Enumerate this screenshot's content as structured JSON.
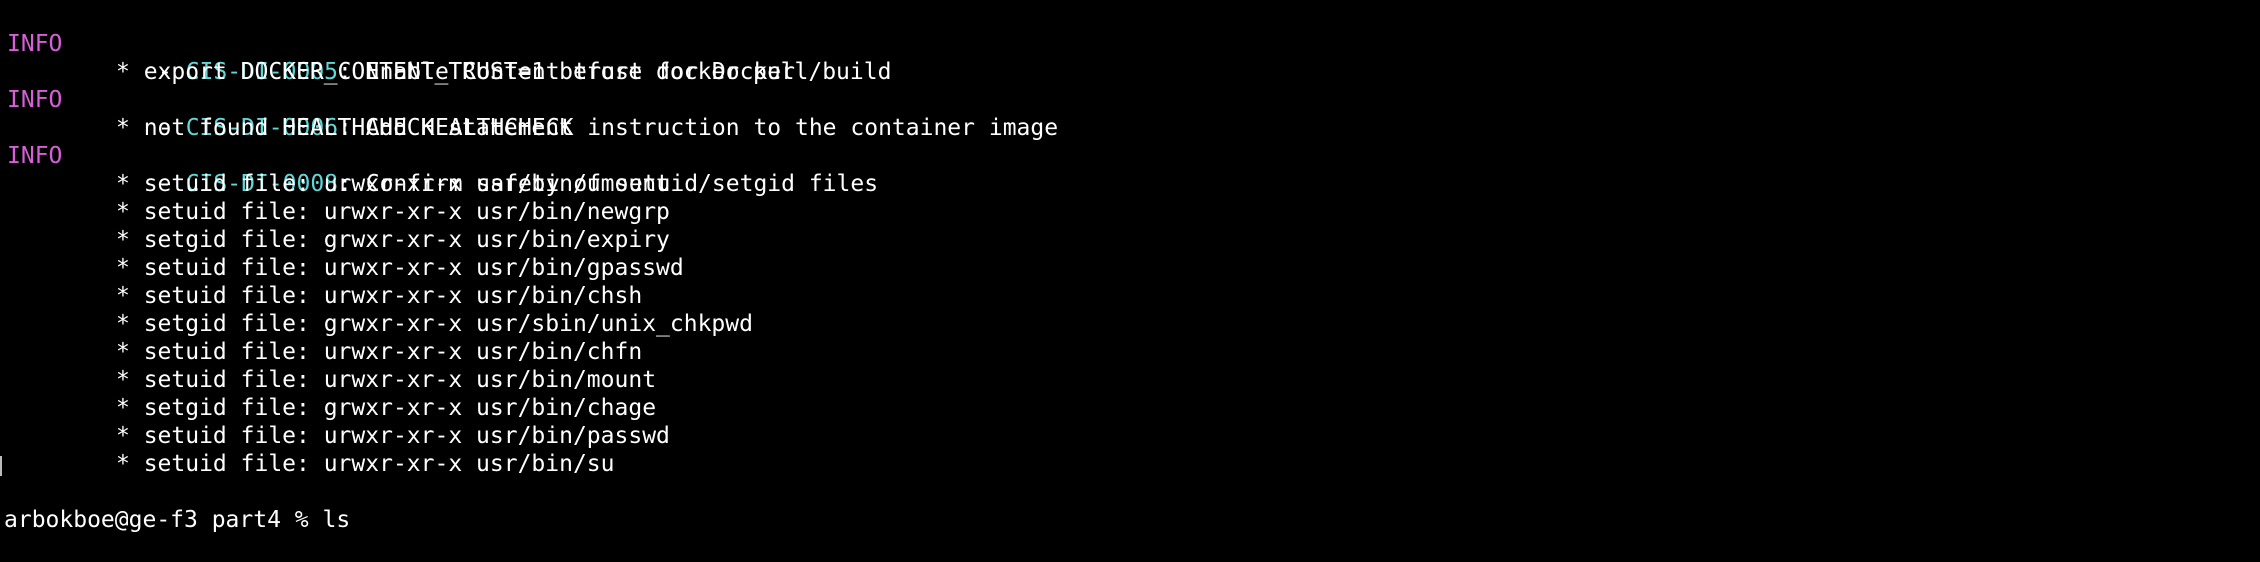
{
  "checks": [
    {
      "level": "INFO",
      "code": "CIS-DI-0005",
      "title": ": Enable Content trust for Docker",
      "details": [
        "* export DOCKER_CONTENT_TRUST=1 before docker pull/build"
      ]
    },
    {
      "level": "INFO",
      "code": "CIS-DI-0006",
      "title": ": Add HEALTHCHECK instruction to the container image",
      "details": [
        "* not found HEALTHCHECK statement"
      ]
    },
    {
      "level": "INFO",
      "code": "CIS-DI-0008",
      "title": ": Confirm safety of setuid/setgid files",
      "details": [
        "* setuid file: urwxr-xr-x usr/bin/umount",
        "* setuid file: urwxr-xr-x usr/bin/newgrp",
        "* setgid file: grwxr-xr-x usr/bin/expiry",
        "* setuid file: urwxr-xr-x usr/bin/gpasswd",
        "* setuid file: urwxr-xr-x usr/bin/chsh",
        "* setgid file: grwxr-xr-x usr/sbin/unix_chkpwd",
        "* setuid file: urwxr-xr-x usr/bin/chfn",
        "* setuid file: urwxr-xr-x usr/bin/mount",
        "* setgid file: grwxr-xr-x usr/bin/chage",
        "* setuid file: urwxr-xr-x usr/bin/passwd",
        "* setuid file: urwxr-xr-x usr/bin/su"
      ]
    }
  ],
  "prompt": {
    "text": "arbokboe@ge-f3 part4 % ls"
  },
  "colors": {
    "background": "#000000",
    "text": "#ffffff",
    "level": "#d75fd7",
    "code": "#5fd7d7"
  }
}
